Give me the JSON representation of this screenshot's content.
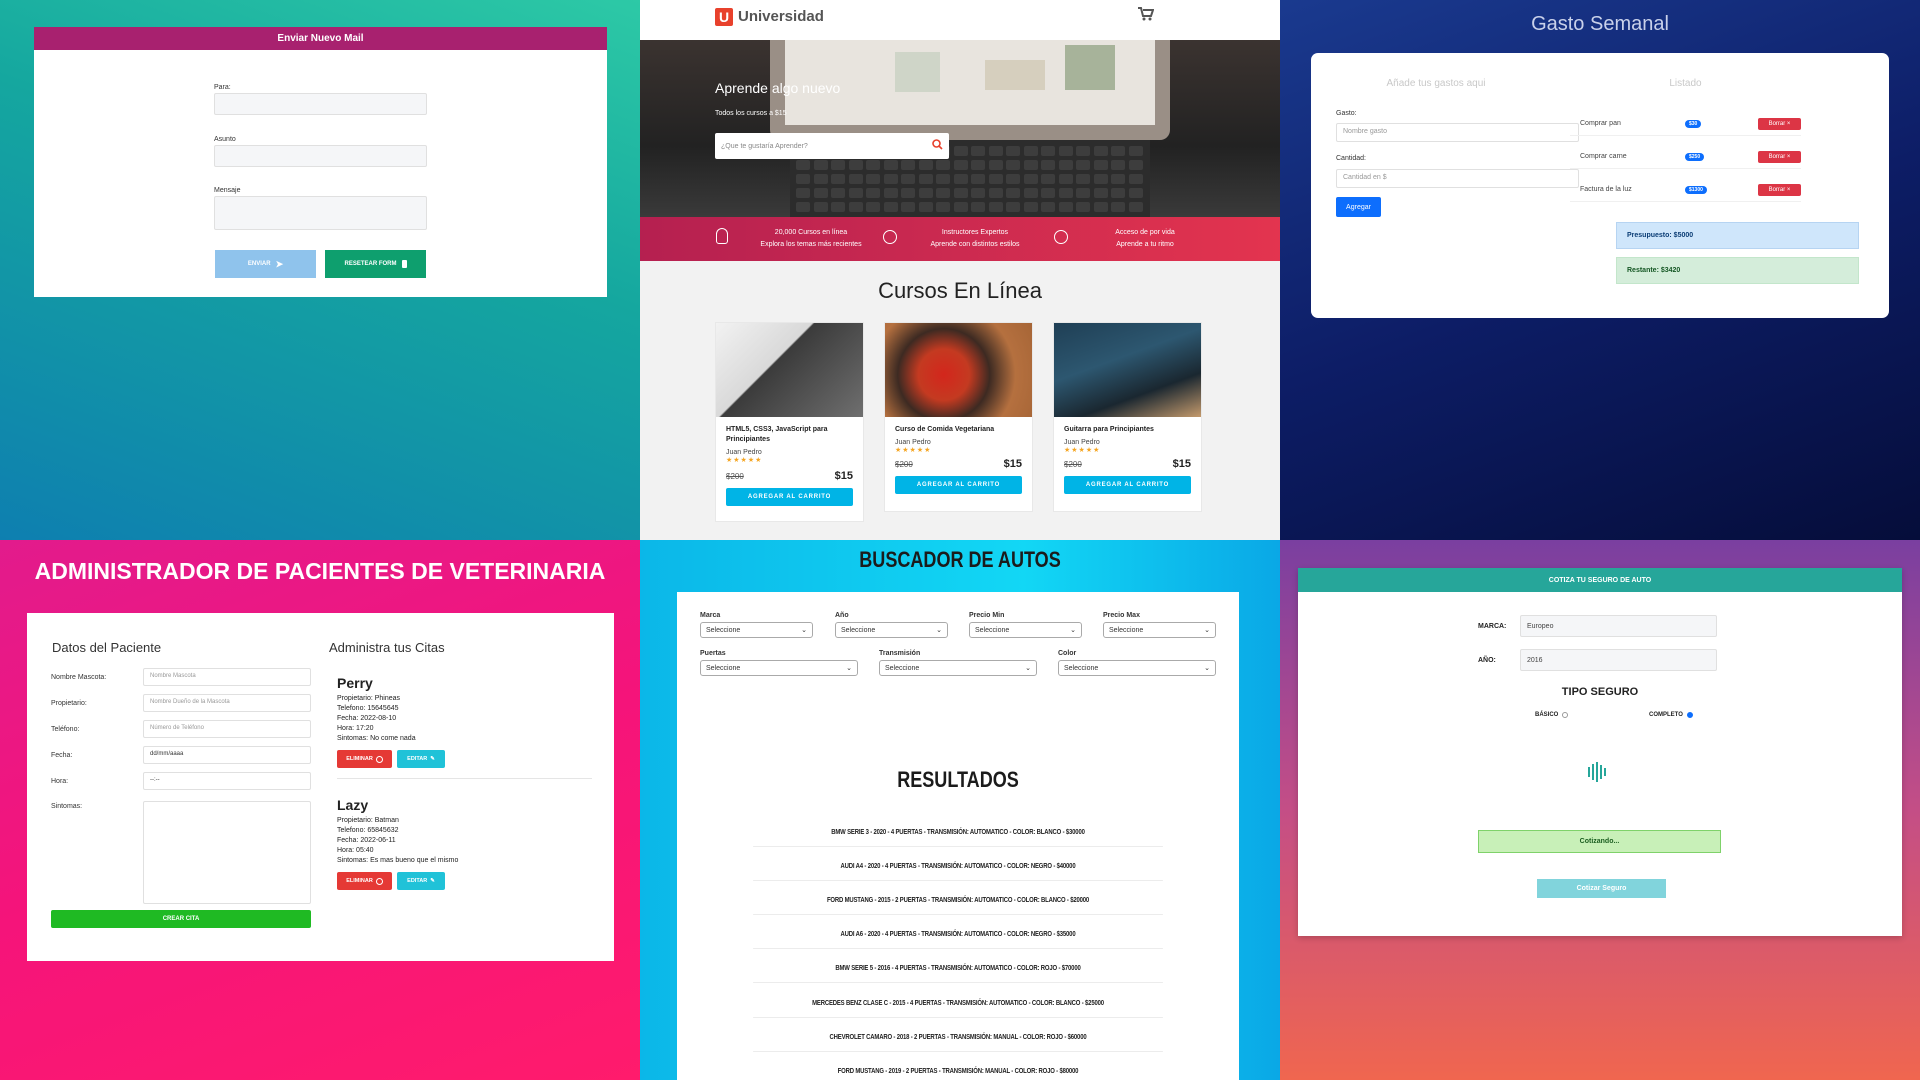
{
  "panel1": {
    "header": "Enviar Nuevo Mail",
    "para_label": "Para:",
    "asunto_label": "Asunto",
    "mensaje_label": "Mensaje",
    "enviar_label": "ENVIAR",
    "reset_label": "RESETEAR FORM",
    "colors": {
      "header": "#a8216f",
      "enviar": "#8fc3ec",
      "reset": "#0e9f6e"
    }
  },
  "panel2": {
    "brand": "Universidad",
    "hero_title": "Aprende algo nuevo",
    "hero_subtitle": "Todos los cursos a $15",
    "search_placeholder": "¿Que te gustaría Aprender?",
    "features": [
      {
        "line1": "20,000 Cursos en línea",
        "line2": "Explora los temas más recientes"
      },
      {
        "line1": "Instructores Expertos",
        "line2": "Aprende con distintos estilos"
      },
      {
        "line1": "Acceso de por vida",
        "line2": "Aprende a tu ritmo"
      }
    ],
    "section_title": "Cursos En Línea",
    "courses": [
      {
        "title": "HTML5, CSS3, JavaScript para Principiantes",
        "author": "Juan Pedro",
        "old_price": "$200",
        "price": "$15",
        "button": "AGREGAR AL CARRITO"
      },
      {
        "title": "Curso de Comida Vegetariana",
        "author": "Juan Pedro",
        "old_price": "$200",
        "price": "$15",
        "button": "AGREGAR AL CARRITO"
      },
      {
        "title": "Guitarra para Principiantes",
        "author": "Juan Pedro",
        "old_price": "$200",
        "price": "$15",
        "button": "AGREGAR AL CARRITO"
      }
    ]
  },
  "panel3": {
    "title": "Gasto Semanal",
    "add_heading": "Añade tus gastos aqui",
    "list_heading": "Listado",
    "gasto_label": "Gasto:",
    "gasto_placeholder": "Nombre gasto",
    "cantidad_label": "Cantidad:",
    "cantidad_placeholder": "Cantidad en $",
    "agregar_label": "Agregar",
    "items": [
      {
        "name": "Comprar pan",
        "amount": "$30",
        "delete": "Borrar ×"
      },
      {
        "name": "Comprar carne",
        "amount": "$250",
        "delete": "Borrar ×"
      },
      {
        "name": "Factura de la luz",
        "amount": "$1300",
        "delete": "Borrar ×"
      }
    ],
    "presupuesto": "Presupuesto: $5000",
    "restante": "Restante: $3420"
  },
  "panel4": {
    "title": "ADMINISTRADOR DE PACIENTES DE VETERINARIA",
    "form_heading": "Datos del Paciente",
    "citas_heading": "Administra tus Citas",
    "fields": [
      {
        "label": "Nombre Mascota:",
        "placeholder": "Nombre Mascota"
      },
      {
        "label": "Propietario:",
        "placeholder": "Nombre Dueño de la Mascota"
      },
      {
        "label": "Teléfono:",
        "placeholder": "Número de Teléfono"
      },
      {
        "label": "Fecha:",
        "placeholder": "dd/mm/aaaa"
      },
      {
        "label": "Hora:",
        "placeholder": "--:--"
      }
    ],
    "sintomas_label": "Sintomas:",
    "crear_label": "CREAR CITA",
    "citas": [
      {
        "name": "Perry",
        "lines": [
          "Propietario: Phineas",
          "Telefono: 15645645",
          "Fecha: 2022-08-10",
          "Hora: 17:20",
          "Sintomas: No come nada"
        ],
        "eliminar": "ELIMINAR",
        "editar": "EDITAR"
      },
      {
        "name": "Lazy",
        "lines": [
          "Propietario: Batman",
          "Telefono: 65845632",
          "Fecha: 2022-06-11",
          "Hora: 05:40",
          "Sintomas: Es mas bueno que el mismo"
        ],
        "eliminar": "ELIMINAR",
        "editar": "EDITAR"
      }
    ]
  },
  "panel5": {
    "title": "BUSCADOR DE AUTOS",
    "filters_row1": [
      {
        "label": "Marca",
        "value": "Seleccione"
      },
      {
        "label": "Año",
        "value": "Seleccione"
      },
      {
        "label": "Precio Min",
        "value": "Seleccione"
      },
      {
        "label": "Precio Max",
        "value": "Seleccione"
      }
    ],
    "filters_row2": [
      {
        "label": "Puertas",
        "value": "Seleccione"
      },
      {
        "label": "Transmisión",
        "value": "Seleccione"
      },
      {
        "label": "Color",
        "value": "Seleccione"
      }
    ],
    "results_title": "RESULTADOS",
    "results": [
      "BMW SERIE 3 - 2020 - 4 PUERTAS - TRANSMISIÓN: AUTOMATICO - COLOR: BLANCO - $30000",
      "AUDI A4 - 2020 - 4 PUERTAS - TRANSMISIÓN: AUTOMATICO - COLOR: NEGRO - $40000",
      "FORD MUSTANG - 2015 - 2 PUERTAS - TRANSMISIÓN: AUTOMATICO - COLOR: BLANCO - $20000",
      "AUDI A6 - 2020 - 4 PUERTAS - TRANSMISIÓN: AUTOMATICO - COLOR: NEGRO - $35000",
      "BMW SERIE 5 - 2016 - 4 PUERTAS - TRANSMISIÓN: AUTOMATICO - COLOR: ROJO - $70000",
      "MERCEDES BENZ CLASE C - 2015 - 4 PUERTAS - TRANSMISIÓN: AUTOMATICO - COLOR: BLANCO - $25000",
      "CHEVROLET CAMARO - 2018 - 2 PUERTAS - TRANSMISIÓN: MANUAL - COLOR: ROJO - $60000",
      "FORD MUSTANG - 2019 - 2 PUERTAS - TRANSMISIÓN: MANUAL - COLOR: ROJO - $80000"
    ]
  },
  "panel6": {
    "header": "COTIZA TU SEGURO DE AUTO",
    "marca_label": "MARCA:",
    "marca_value": "Europeo",
    "anio_label": "AÑO:",
    "anio_value": "2016",
    "tipo_heading": "TIPO SEGURO",
    "basico_label": "BÁSICO",
    "completo_label": "COMPLETO",
    "basico_checked": false,
    "completo_checked": true,
    "status": "Cotizando...",
    "cotizar_label": "Cotizar Seguro"
  }
}
